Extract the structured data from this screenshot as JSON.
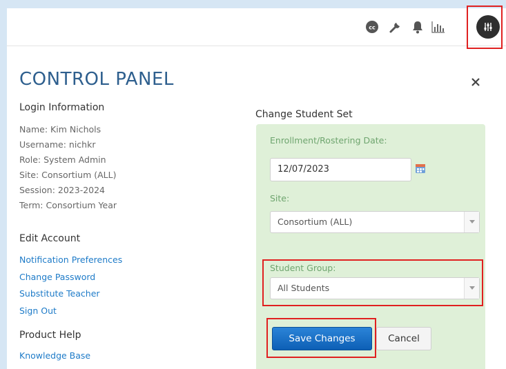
{
  "header": {
    "icons": [
      "cc-icon",
      "wrench-icon",
      "bell-icon",
      "chart-icon",
      "settings-sliders-icon"
    ]
  },
  "panel": {
    "title": "CONTROL PANEL",
    "close_label": "×"
  },
  "login_info": {
    "heading": "Login Information",
    "name": "Name: Kim Nichols",
    "username": "Username: nichkr",
    "role": "Role: System Admin",
    "site": "Site: Consortium (ALL)",
    "session": "Session: 2023-2024",
    "term": "Term: Consortium Year"
  },
  "edit_account": {
    "heading": "Edit Account",
    "links": [
      "Notification Preferences",
      "Change Password",
      "Substitute Teacher",
      "Sign Out"
    ]
  },
  "product_help": {
    "heading": "Product Help",
    "links": [
      "Knowledge Base"
    ]
  },
  "student_set": {
    "heading": "Change Student Set",
    "date_label": "Enrollment/Rostering Date:",
    "date_value": "12/07/2023",
    "site_label": "Site:",
    "site_value": "Consortium (ALL)",
    "group_label": "Student Group:",
    "group_value": "All Students",
    "save_label": "Save Changes",
    "cancel_label": "Cancel"
  },
  "colors": {
    "accent": "#1e7bc8",
    "title": "#2e5f8e",
    "panel_bg": "#dff0d8",
    "highlight": "#e02020"
  }
}
